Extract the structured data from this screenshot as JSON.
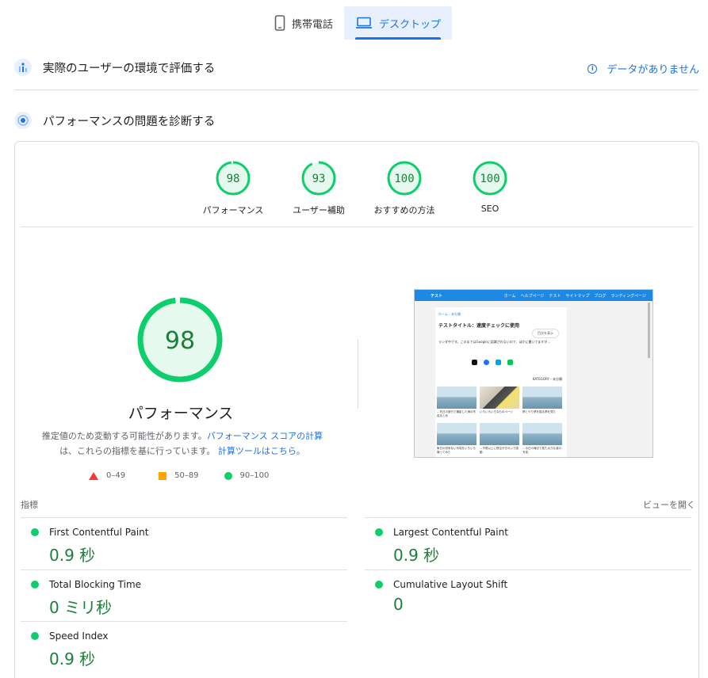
{
  "tabs": [
    {
      "label": "携帯電話",
      "icon": "phone-icon",
      "active": false
    },
    {
      "label": "デスクトップ",
      "icon": "laptop-icon",
      "active": true
    }
  ],
  "field_section": {
    "title": "実際のユーザーの環境で評価する",
    "no_data": "データがありません"
  },
  "lab_section": {
    "title": "パフォーマンスの問題を診断する"
  },
  "scores": [
    {
      "value": "98",
      "label": "パフォーマンス"
    },
    {
      "value": "93",
      "label": "ユーザー補助"
    },
    {
      "value": "100",
      "label": "おすすめの方法"
    },
    {
      "value": "100",
      "label": "SEO"
    }
  ],
  "performance": {
    "score": "98",
    "title": "パフォーマンス",
    "desc_1": "推定値のため変動する可能性があります。",
    "desc_link_1": "パフォーマンス スコアの計算",
    "desc_2": "は、これらの指標を基に行っています。",
    "desc_link_2": "計算ツールはこちら。"
  },
  "legend": [
    {
      "label": "0–49"
    },
    {
      "label": "50–89"
    },
    {
      "label": "90–100"
    }
  ],
  "thumbnail": {
    "site_name": "テスト",
    "nav": [
      "ホーム",
      "ヘルプページ",
      "テスト",
      "サイトマップ",
      "ブログ",
      "ランディングページ"
    ],
    "breadcrumb": "ホーム › 未分類",
    "post_title": "テストタイトル：速度チェックに使用",
    "share": "目次を表示",
    "body": "ランダ中です。このまではGoogleに認識されないので、ほかに書いてますが…",
    "category": "KATEGORY・未分類",
    "captions": [
      "…先日の旅行で撮影した海の写真まとめ",
      "いろいろいろなものページ",
      "夢とやり夢を描る夢を見た",
      "毎日の何気ない写真をいろいろ撮ってみた",
      "…予想以上に夜空がきれいで感動",
      "…今日の海辺で見た大きな波の写真"
    ]
  },
  "metrics": {
    "header_left": "指標",
    "header_right": "ビューを開く",
    "items": [
      {
        "name": "First Contentful Paint",
        "value": "0.9 秒"
      },
      {
        "name": "Largest Contentful Paint",
        "value": "0.9 秒"
      },
      {
        "name": "Total Blocking Time",
        "value": "0 ミリ秒"
      },
      {
        "name": "Cumulative Layout Shift",
        "value": "0"
      },
      {
        "name": "Speed Index",
        "value": "0.9 秒"
      }
    ]
  },
  "colors": {
    "good": "#0cce6b",
    "average": "#ffa400",
    "poor": "#ff3333",
    "accent": "#1a73e8"
  }
}
